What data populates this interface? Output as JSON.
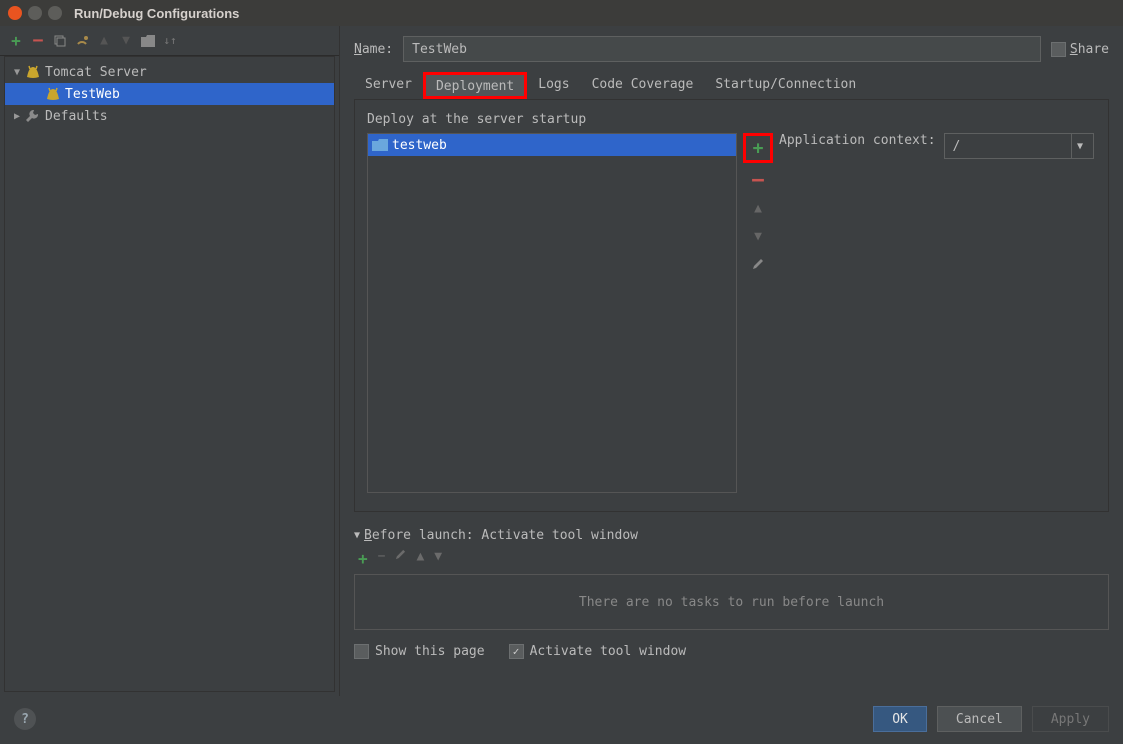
{
  "window": {
    "title": "Run/Debug Configurations"
  },
  "tree": {
    "server_group": "Tomcat Server",
    "server_item": "TestWeb",
    "defaults": "Defaults"
  },
  "name": {
    "label": "Name:",
    "value": "TestWeb"
  },
  "share": {
    "label": "Share"
  },
  "tabs": {
    "server": "Server",
    "deployment": "Deployment",
    "logs": "Logs",
    "code_coverage": "Code Coverage",
    "startup": "Startup/Connection"
  },
  "deploy": {
    "heading": "Deploy at the server startup",
    "item": "testweb",
    "context_label": "Application context:",
    "context_value": "/"
  },
  "before_launch": {
    "heading": "Before launch: Activate tool window",
    "empty": "There are no tasks to run before launch"
  },
  "checks": {
    "show_page": "Show this page",
    "activate": "Activate tool window"
  },
  "buttons": {
    "ok": "OK",
    "cancel": "Cancel",
    "apply": "Apply"
  }
}
